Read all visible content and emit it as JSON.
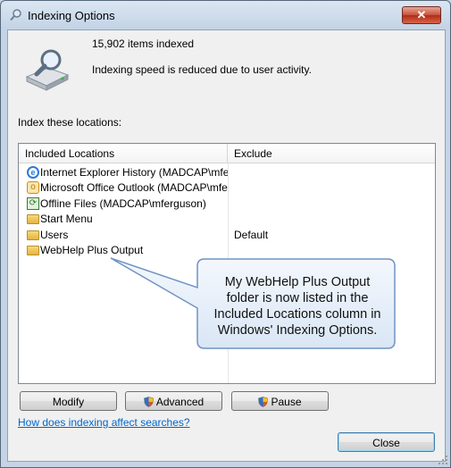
{
  "window": {
    "title": "Indexing Options",
    "close_symbol": "✕"
  },
  "status": {
    "items_indexed": "15,902 items indexed",
    "speed_message": "Indexing speed is reduced due to user activity."
  },
  "index_label": "Index these locations:",
  "list": {
    "headers": {
      "included": "Included Locations",
      "exclude": "Exclude"
    },
    "rows": [
      {
        "name": "Internet Explorer History (MADCAP\\mfer...",
        "exclude": "",
        "icon": "ie-icon"
      },
      {
        "name": "Microsoft Office Outlook (MADCAP\\mfer...",
        "exclude": "",
        "icon": "outlook-icon"
      },
      {
        "name": "Offline Files (MADCAP\\mferguson)",
        "exclude": "",
        "icon": "offline-files-icon"
      },
      {
        "name": "Start Menu",
        "exclude": "",
        "icon": "folder-icon"
      },
      {
        "name": "Users",
        "exclude": "Default",
        "icon": "folder-icon"
      },
      {
        "name": "WebHelp Plus Output",
        "exclude": "",
        "icon": "folder-icon"
      }
    ]
  },
  "callout": {
    "text": "My WebHelp Plus Output folder is now listed in the Included Locations column in Windows' Indexing Options."
  },
  "buttons": {
    "modify": "Modify",
    "advanced": "Advanced",
    "pause": "Pause",
    "close": "Close"
  },
  "help_link": "How does indexing affect searches?"
}
